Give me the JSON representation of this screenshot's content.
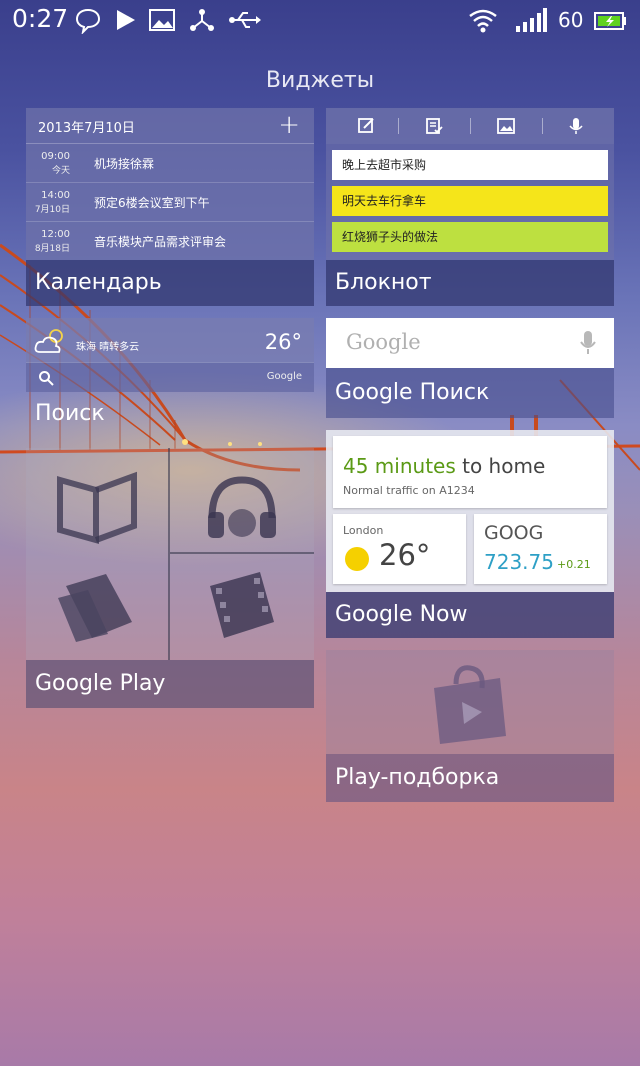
{
  "status_bar": {
    "time": "0:27",
    "battery_level": "60",
    "icons": [
      "chat-icon",
      "play-icon",
      "image-icon",
      "share-icon",
      "usb-icon",
      "wifi-icon",
      "signal-icon",
      "battery-icon"
    ]
  },
  "page_title": "Виджеты",
  "calendar": {
    "date": "2013年7月10日",
    "add_label": "+",
    "events": [
      {
        "time": "09:00",
        "sub": "今天",
        "title": "机场接徐霖"
      },
      {
        "time": "14:00",
        "sub": "7月10日",
        "title": "预定6楼会议室到下午"
      },
      {
        "time": "12:00",
        "sub": "8月18日",
        "title": "音乐模块产品需求评审会"
      }
    ],
    "label": "Календарь"
  },
  "notepad": {
    "items": [
      {
        "text": "晚上去超市采购",
        "color": "#ffffff"
      },
      {
        "text": "明天去车行拿车",
        "color": "#f5e51a"
      },
      {
        "text": "红烧狮子头的做法",
        "color": "#bde040"
      }
    ],
    "label": "Блокнот"
  },
  "search_widget": {
    "city_weather": "珠海  晴转多云",
    "temperature": "26°",
    "search_hint": "Google",
    "label": "Поиск"
  },
  "google_search": {
    "logo": "Google",
    "label": "Google Поиск"
  },
  "google_now": {
    "commute_minutes": "45 minutes",
    "commute_dest": " to home",
    "traffic": "Normal traffic on A1234",
    "weather_city": "London",
    "weather_temp": "26°",
    "stock_ticker": "GOOG",
    "stock_price": "723.75",
    "stock_change": "+0.21",
    "label": "Google Now"
  },
  "google_play": {
    "label": "Google Play"
  },
  "play_picks": {
    "label": "Play-подборка"
  }
}
